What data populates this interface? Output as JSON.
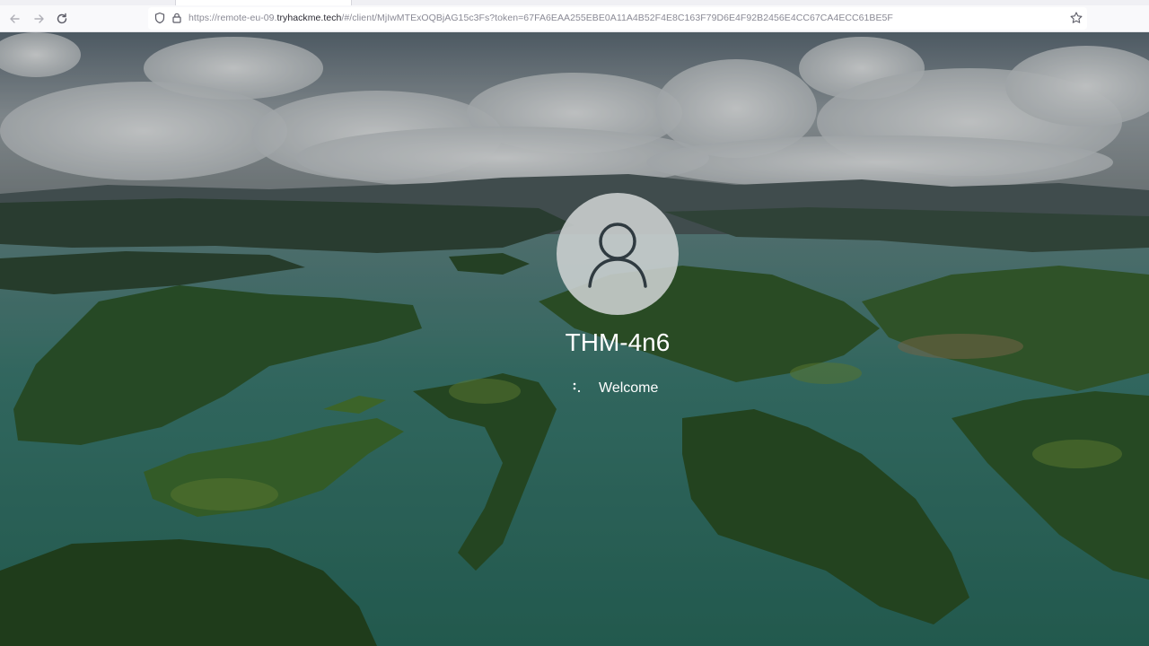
{
  "browser": {
    "url_prefix": "https://remote-eu-09.",
    "url_host": "tryhackme.tech",
    "url_suffix": "/#/client/MjIwMTExOQBjAG15c3Fs?token=67FA6EAA255EBE0A11A4B52F4E8C163F79D6E4F92B2456E4CC67CA4ECC61BE5F",
    "icons": [
      "back-arrow-icon",
      "forward-arrow-icon",
      "reload-icon",
      "shield-icon",
      "lock-icon",
      "bookmark-star-icon"
    ]
  },
  "lock_screen": {
    "username": "THM-4n6",
    "status": "Welcome",
    "icons": [
      "user-avatar-icon",
      "loading-spinner-icon"
    ]
  },
  "colors": {
    "chrome_bg": "#f9f9fb",
    "url_text": "#8a8a95",
    "water": "#2f6e64",
    "sky": "#c9cfd2"
  }
}
